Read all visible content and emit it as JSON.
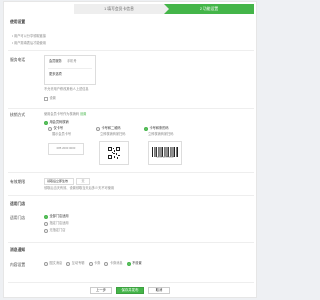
{
  "steps": [
    "1 填写会员卡信息",
    "2 功能设置"
  ],
  "header": {
    "section": "使用设置",
    "bullet1": "用户可以分享领取链接",
    "bullet2": "用户需填表后才能使用"
  },
  "services": {
    "label": "服务电话",
    "placeholder1": "会员服务",
    "placeholder2": "手机号",
    "extra": "更多选项",
    "note": "不允许用户修改其他人上述信息"
  },
  "privilege": {
    "checkbox_label": "设置"
  },
  "code_type": {
    "label": "核销方式",
    "subtitle": "使用会员卡号作为核销码",
    "link": "设置",
    "option_sn": "用会员码核销",
    "col1_title": "仅卡号",
    "col1_desc": "展示会员卡号",
    "col1_num": "085 2000 0000",
    "col2_title": "卡号和二维码",
    "col2_desc": "立即核销商家扫码",
    "col3_title": "卡号和条形码",
    "col3_desc": "立即核销商家扫码",
    "barcode_num": "1234 5678 9012"
  },
  "expire": {
    "label": "有效期限",
    "select": "领取后立即生效",
    "unit": "天",
    "note": "领取后当天有效、设置领取当天后多少天不可使用"
  },
  "store": {
    "section": "适用门店",
    "label": "适用门店",
    "opt1": "全部门店适用",
    "opt2": "指定门店适用",
    "opt3": "无指定门店"
  },
  "notify": {
    "section": "消息通知"
  },
  "content": {
    "label": "内容设置",
    "items": [
      "图文消息",
      "互动专辑",
      "卡券",
      "卡券消息",
      "不设置"
    ]
  },
  "footer": {
    "prev": "上一步",
    "save": "保存并发布",
    "cancel": "取消"
  }
}
